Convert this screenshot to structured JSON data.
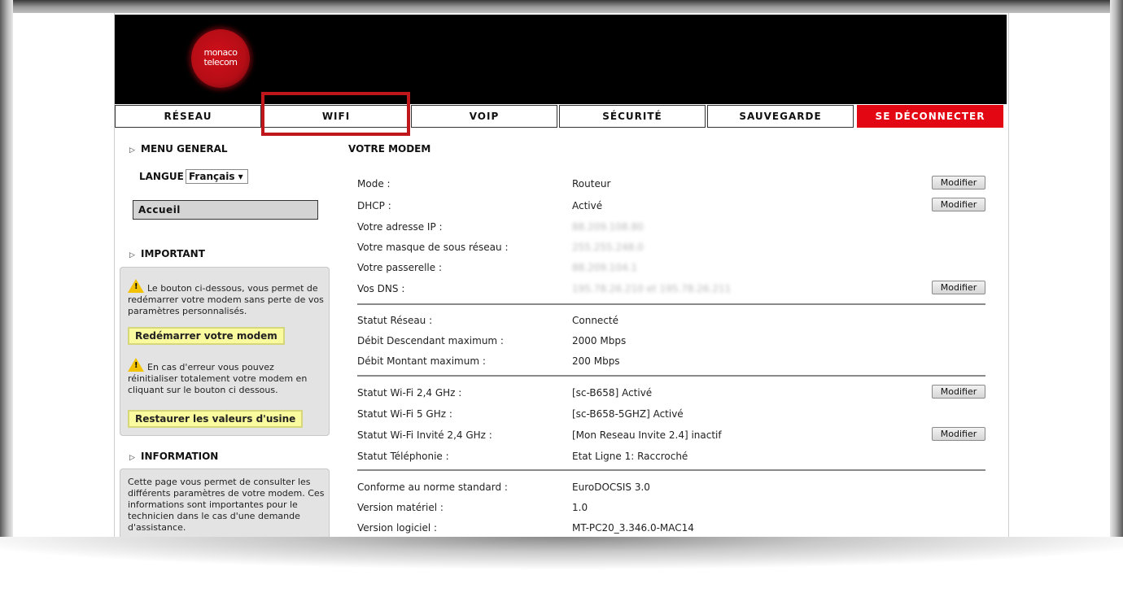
{
  "logo": {
    "line1": "monaco",
    "line2": "telecom"
  },
  "nav": {
    "reseau": "RÉSEAU",
    "wifi": "WIFI",
    "voip": "VOIP",
    "securite": "SÉCURITÉ",
    "sauvegarde": "SAUVEGARDE",
    "logout": "SE DÉCONNECTER"
  },
  "sidebar": {
    "menu_general": "MENU GENERAL",
    "language_label": "LANGUE",
    "language_value": "Français ▾",
    "accueil": "Accueil",
    "important": "IMPORTANT",
    "important_text1": "Le bouton ci-dessous, vous permet de redémarrer votre modem sans perte de vos paramètres personnalisés.",
    "restart_button": "Redémarrer votre modem",
    "important_text2": "En cas d'erreur vous pouvez réinitialiser totalement votre modem en cliquant sur le bouton ci dessous.",
    "reset_button": "Restaurer les valeurs d'usine",
    "information": "INFORMATION",
    "info_text": "Cette page vous permet de consulter les différents paramètres de votre modem. Ces informations sont importantes pour le technicien dans le cas d'une demande d'assistance."
  },
  "main": {
    "title": "VOTRE MODEM",
    "modify_label": "Modifier",
    "rows": [
      {
        "label": "Mode :",
        "value": "Routeur"
      },
      {
        "label": "DHCP :",
        "value": "Activé"
      },
      {
        "label": "Votre adresse IP :",
        "value": "88.209.108.80"
      },
      {
        "label": "Votre masque de sous réseau :",
        "value": "255.255.248.0"
      },
      {
        "label": "Votre passerelle :",
        "value": "88.209.104.1"
      },
      {
        "label": "Vos DNS :",
        "value": "195.78.26.210 et 195.78.26.211"
      },
      {
        "label": "Statut Réseau :",
        "value": "Connecté"
      },
      {
        "label": "Débit Descendant maximum :",
        "value": "2000 Mbps"
      },
      {
        "label": "Débit Montant maximum :",
        "value": "200 Mbps"
      },
      {
        "label": "Statut Wi-Fi 2,4 GHz :",
        "value": "[sc-B658] Activé"
      },
      {
        "label": "Statut Wi-Fi 5 GHz :",
        "value": "[sc-B658-5GHZ] Activé"
      },
      {
        "label": "Statut Wi-Fi Invité 2,4 GHz :",
        "value": "[Mon Reseau Invite 2.4] inactif"
      },
      {
        "label": "Statut Téléphonie :",
        "value": "Etat Ligne 1: Raccroché"
      },
      {
        "label": "Conforme au norme standard :",
        "value": "EuroDOCSIS 3.0"
      },
      {
        "label": "Version matériel :",
        "value": "1.0"
      },
      {
        "label": "Version logiciel :",
        "value": "MT-PC20_3.346.0-MAC14"
      }
    ]
  },
  "colors": {
    "brand_red": "#e30613",
    "highlight_red": "#c0171d",
    "header_black": "#000000"
  }
}
